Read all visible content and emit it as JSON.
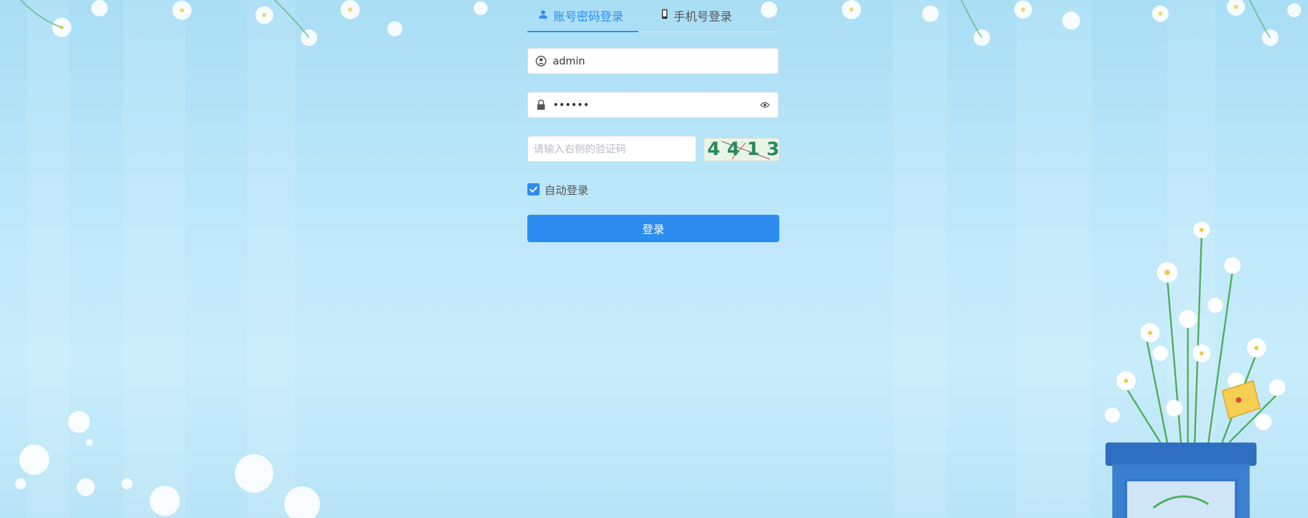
{
  "tabs": {
    "account_label": "账号密码登录",
    "phone_label": "手机号登录",
    "active": "account"
  },
  "form": {
    "username_value": "admin",
    "password_value": "••••••",
    "captcha_placeholder": "请输入右侧的验证码",
    "captcha_text": "4413"
  },
  "remember": {
    "label": "自动登录",
    "checked": true
  },
  "login_button_label": "登录",
  "icons": {
    "account_tab": "user-icon",
    "phone_tab": "mobile-icon",
    "username": "user-circle-icon",
    "password": "lock-icon",
    "password_toggle": "eye-icon",
    "remember": "checkbox-checked-icon"
  },
  "colors": {
    "accent": "#2d8cf0",
    "background": "#bfe8fa"
  }
}
